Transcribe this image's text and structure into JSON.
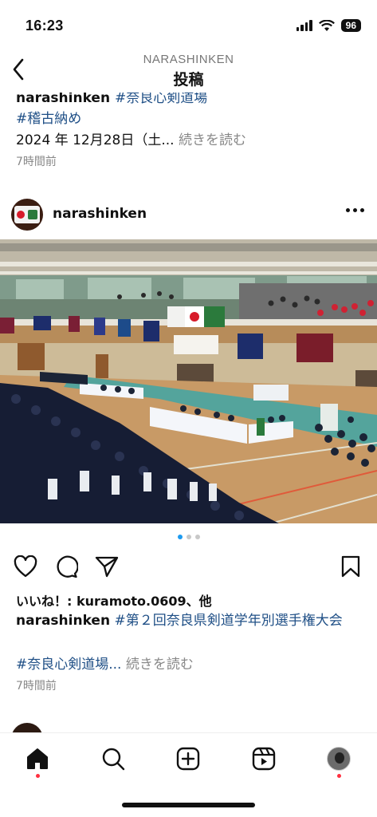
{
  "status_bar": {
    "time": "16:23",
    "battery": "96"
  },
  "header": {
    "account": "NARASHINKEN",
    "title": "投稿"
  },
  "previous_post": {
    "clipped_line_user": "narashinken ",
    "clipped_line_tag": "#奈良心剣道場",
    "tag": "#稽古納め",
    "date_text": "2024 年 12月28日（土...",
    "more_label": "続きを読む",
    "time_ago": "7時間前"
  },
  "post": {
    "username": "narashinken",
    "image_alt": "剣道大会の開会式（体育館）",
    "likes_prefix": "いいね！: ",
    "likes_user": "kuramoto.0609",
    "likes_suffix": "、他",
    "caption_user": "narashinken",
    "caption_tag": " #第２回奈良県剣道学年別選手権大会",
    "caption_tag2": "#奈良心剣道場...",
    "more_label": "続きを読む",
    "time_ago": "7時間前",
    "carousel_total": 3,
    "carousel_active": 1
  },
  "icons": {
    "back": "chevron-left-icon",
    "like": "heart-icon",
    "comment": "comment-icon",
    "share": "send-icon",
    "save": "bookmark-icon"
  },
  "colors": {
    "hashtag": "#1f4f86",
    "accent_dot": "#ff3040",
    "carousel_active": "#1d9bf0"
  }
}
